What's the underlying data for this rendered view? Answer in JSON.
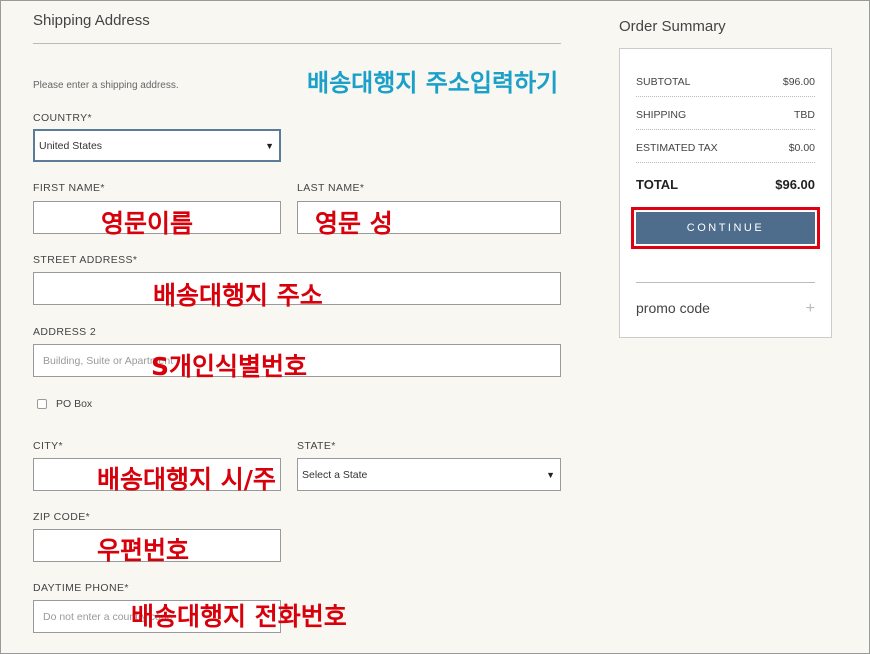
{
  "shipping": {
    "title": "Shipping Address",
    "hint": "Please enter a shipping address.",
    "country_label": "COUNTRY*",
    "country_value": "United States",
    "first_name_label": "FIRST NAME*",
    "last_name_label": "LAST NAME*",
    "street_label": "STREET ADDRESS*",
    "address2_label": "ADDRESS 2",
    "address2_placeholder": "Building, Suite or Apartment",
    "po_box_label": "PO Box",
    "city_label": "CITY*",
    "state_label": "STATE*",
    "state_value": "Select a State",
    "zip_label": "ZIP CODE*",
    "phone_label": "DAYTIME PHONE*",
    "phone_placeholder": "Do not enter a country code"
  },
  "summary": {
    "title": "Order Summary",
    "rows": [
      {
        "label": "SUBTOTAL",
        "value": "$96.00"
      },
      {
        "label": "SHIPPING",
        "value": "TBD"
      },
      {
        "label": "ESTIMATED TAX",
        "value": "$0.00"
      }
    ],
    "total_label": "TOTAL",
    "total_value": "$96.00",
    "continue_label": "CONTINUE",
    "promo_label": "promo code",
    "promo_icon": "+"
  },
  "annotations": {
    "header": "배송대행지 주소입력하기",
    "first_name": "영문이름",
    "last_name": "영문 성",
    "street": "배송대행지 주소",
    "address2": "S개인식별번호",
    "city_state": "배송대행지 시/주",
    "zip": "우편번호",
    "phone": "배송대행지 전화번호"
  },
  "colors": {
    "accent_button": "#4e6c8b",
    "highlight_border": "#e0000f",
    "annotation_red": "#d8000a",
    "annotation_teal": "#1aa0c9"
  }
}
